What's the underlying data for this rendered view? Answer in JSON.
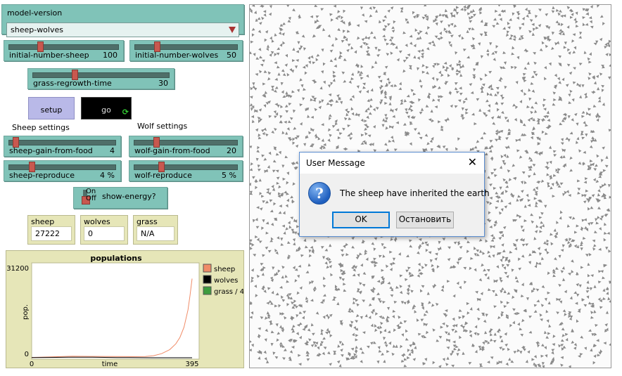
{
  "chooser": {
    "label": "model-version",
    "value": "sheep-wolves"
  },
  "sliders": {
    "initial_number_sheep": {
      "label": "initial-number-sheep",
      "value": "100",
      "fraction": 0.27
    },
    "initial_number_wolves": {
      "label": "initial-number-wolves",
      "value": "50",
      "fraction": 0.2
    },
    "grass_regrowth_time": {
      "label": "grass-regrowth-time",
      "value": "30",
      "fraction": 0.3
    },
    "sheep_gain_from_food": {
      "label": "sheep-gain-from-food",
      "value": "4",
      "fraction": 0.04
    },
    "wolf_gain_from_food": {
      "label": "wolf-gain-from-food",
      "value": "20",
      "fraction": 0.2
    },
    "sheep_reproduce": {
      "label": "sheep-reproduce",
      "value": "4 %",
      "fraction": 0.2
    },
    "wolf_reproduce": {
      "label": "wolf-reproduce",
      "value": "5 %",
      "fraction": 0.25
    }
  },
  "buttons": {
    "setup": "setup",
    "go": "go",
    "go_icon": "forever-arrows-icon"
  },
  "sections": {
    "sheep": "Sheep settings",
    "wolf": "Wolf settings"
  },
  "switch": {
    "label": "show-energy?",
    "on": "On",
    "off": "Off",
    "state": "off"
  },
  "monitors": {
    "sheep": {
      "label": "sheep",
      "value": "27222"
    },
    "wolves": {
      "label": "wolves",
      "value": "0"
    },
    "grass": {
      "label": "grass",
      "value": "N/A"
    }
  },
  "plot": {
    "title": "populations"
  },
  "chart_data": {
    "type": "line",
    "title": "populations",
    "xlabel": "time",
    "ylabel": "pop.",
    "xlim": [
      0,
      395
    ],
    "ylim": [
      0,
      31200
    ],
    "x_tick_labels": [
      "0",
      "395"
    ],
    "y_tick_labels": [
      "0",
      "31200"
    ],
    "legend_position": "right",
    "series": [
      {
        "name": "sheep",
        "color": "#F08C68",
        "points": [
          [
            0,
            100
          ],
          [
            50,
            300
          ],
          [
            100,
            500
          ],
          [
            150,
            450
          ],
          [
            200,
            400
          ],
          [
            250,
            380
          ],
          [
            280,
            420
          ],
          [
            300,
            700
          ],
          [
            320,
            1400
          ],
          [
            340,
            2800
          ],
          [
            355,
            4800
          ],
          [
            365,
            7000
          ],
          [
            375,
            10500
          ],
          [
            385,
            16500
          ],
          [
            390,
            21500
          ],
          [
            395,
            27222
          ]
        ]
      },
      {
        "name": "wolves",
        "color": "#000000",
        "points": [
          [
            0,
            50
          ],
          [
            30,
            90
          ],
          [
            60,
            130
          ],
          [
            90,
            180
          ],
          [
            120,
            200
          ],
          [
            150,
            160
          ],
          [
            180,
            110
          ],
          [
            210,
            70
          ],
          [
            240,
            40
          ],
          [
            270,
            20
          ],
          [
            300,
            8
          ],
          [
            330,
            2
          ],
          [
            360,
            0
          ],
          [
            395,
            0
          ]
        ]
      },
      {
        "name": "grass / 4",
        "color": "#3E9C3E",
        "points": []
      }
    ]
  },
  "dialog": {
    "title": "User Message",
    "close_icon": "close-icon",
    "icon": "question-icon",
    "message": "The sheep have inherited the earth",
    "ok": "OK",
    "stop": "Остановить"
  },
  "view": {
    "agent_color": "#8a8a8a",
    "agent_count_display": 27222
  }
}
